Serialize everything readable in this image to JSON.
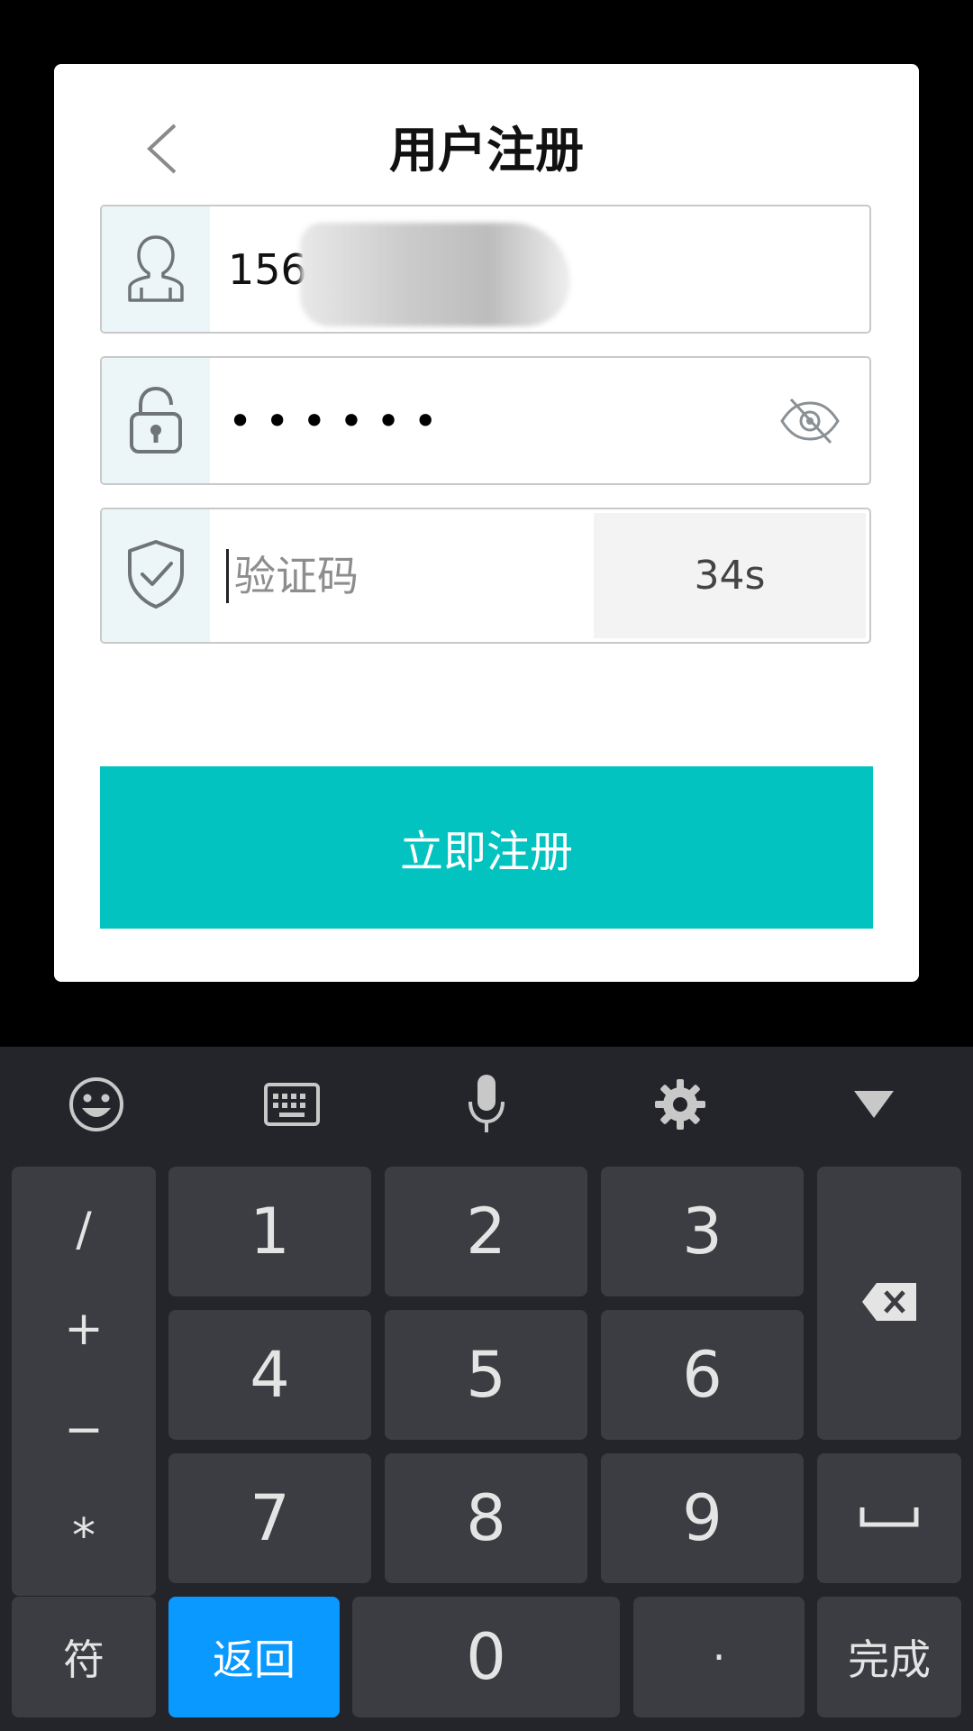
{
  "dialog": {
    "title": "用户注册",
    "phone_value": "156",
    "password_mask": "••••••",
    "code_placeholder": "验证码",
    "countdown": "34s",
    "register_label": "立即注册"
  },
  "keyboard": {
    "toolbar": [
      "emoji-icon",
      "keyboard-icon",
      "microphone-icon",
      "settings-icon",
      "hide-keyboard-icon"
    ],
    "symbols": [
      "/",
      "+",
      "−",
      "*"
    ],
    "digits": [
      "1",
      "2",
      "3",
      "4",
      "5",
      "6",
      "7",
      "8",
      "9"
    ],
    "zero": "0",
    "fu_label": "符",
    "back_label": "返回",
    "dot_label": "·",
    "done_label": "完成"
  },
  "colors": {
    "accent": "#03c3c1",
    "back_key": "#0a99ff",
    "key_bg": "#3b3d42",
    "keyboard_bg": "#23252a"
  }
}
